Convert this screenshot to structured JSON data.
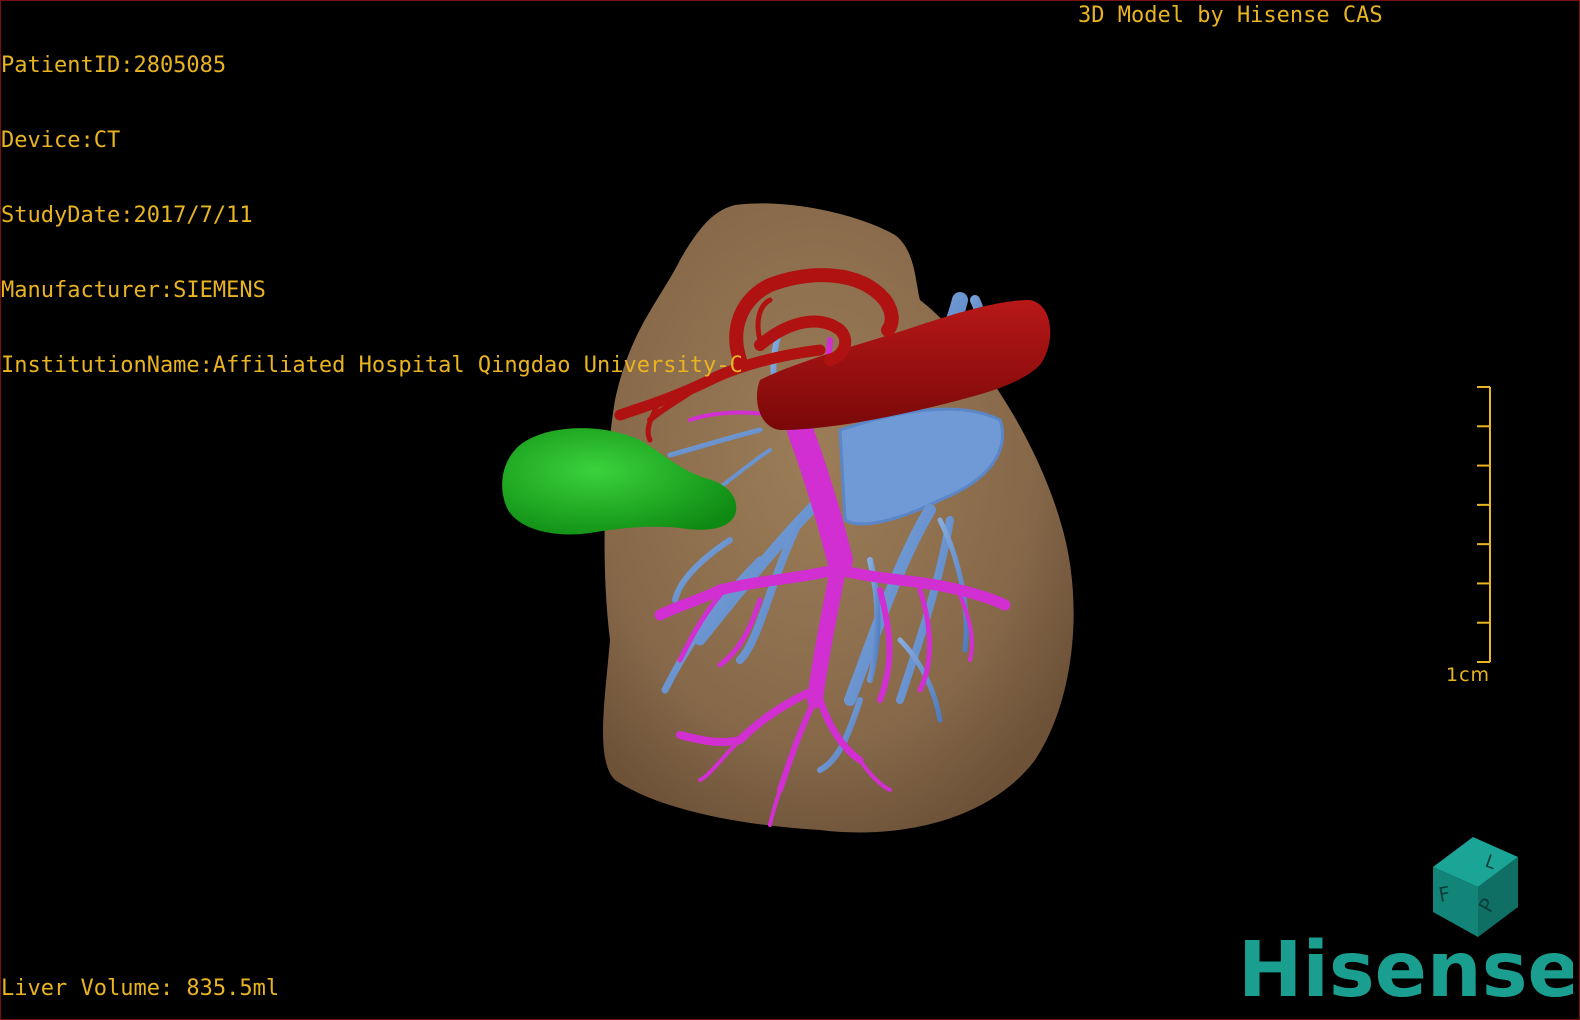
{
  "study_info": {
    "patient_id": "PatientID:2805085",
    "device": "Device:CT",
    "study_date": "StudyDate:2017/7/11",
    "manufacturer": "Manufacturer:SIEMENS",
    "institution": "InstitutionName:Affiliated Hospital Qingdao University-C"
  },
  "model_credit": "3D Model by Hisense CAS",
  "liver_volume": "Liver Volume: 835.5ml",
  "scale_bar": {
    "label": "1cm",
    "tick_count": 8
  },
  "orientation_cube": {
    "labels": [
      "F",
      "L",
      "P"
    ]
  },
  "brand": {
    "name": "Hisense"
  },
  "colors": {
    "overlay_text": "#e9b422",
    "liver": "#8b6d4b",
    "hepatic_artery": "#b01212",
    "inferior_vena_cava": "#a10d0d",
    "portal_vein": "#d12fd1",
    "hepatic_vein": "#6f9ad6",
    "gallbladder": "#17a31a",
    "brand": "#1a9e8f"
  }
}
